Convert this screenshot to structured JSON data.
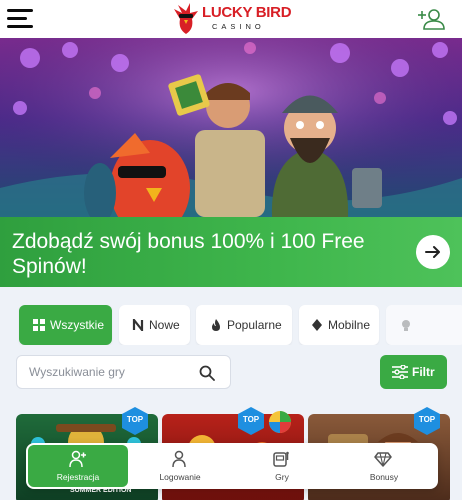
{
  "brand": {
    "title": "LUCKY BIRD",
    "subtitle": "CASINO",
    "primary_color": "#3aaa44",
    "logo_color": "#d81f26"
  },
  "header": {
    "menu_icon": "hamburger-icon",
    "account_icon": "user-add-icon"
  },
  "promo": {
    "text": "Zdobądź swój bonus 100% i 100 Free Spinów!",
    "button_icon": "arrow-right-icon"
  },
  "categories": [
    {
      "label": "Wszystkie",
      "icon": "grid-icon",
      "active": true
    },
    {
      "label": "Nowe",
      "icon": "new-icon",
      "active": false
    },
    {
      "label": "Popularne",
      "icon": "fire-icon",
      "active": false
    },
    {
      "label": "Mobilne",
      "icon": "diamond-icon",
      "active": false
    },
    {
      "label": "",
      "icon": "bulb-icon",
      "active": false
    }
  ],
  "search": {
    "placeholder": "Wyszukiwanie gry",
    "value": ""
  },
  "filter": {
    "label": "Filtr"
  },
  "games": [
    {
      "badge": "TOP",
      "caption": "SUMMER EDITION"
    },
    {
      "badge": "TOP",
      "caption": ""
    },
    {
      "badge": "TOP",
      "caption": ""
    }
  ],
  "bottom_nav": [
    {
      "label": "Rejestracja",
      "icon": "user-plus-icon",
      "active": true
    },
    {
      "label": "Logowanie",
      "icon": "user-icon",
      "active": false
    },
    {
      "label": "Gry",
      "icon": "slot-machine-icon",
      "active": false
    },
    {
      "label": "Bonusy",
      "icon": "diamond-icon",
      "active": false
    }
  ]
}
